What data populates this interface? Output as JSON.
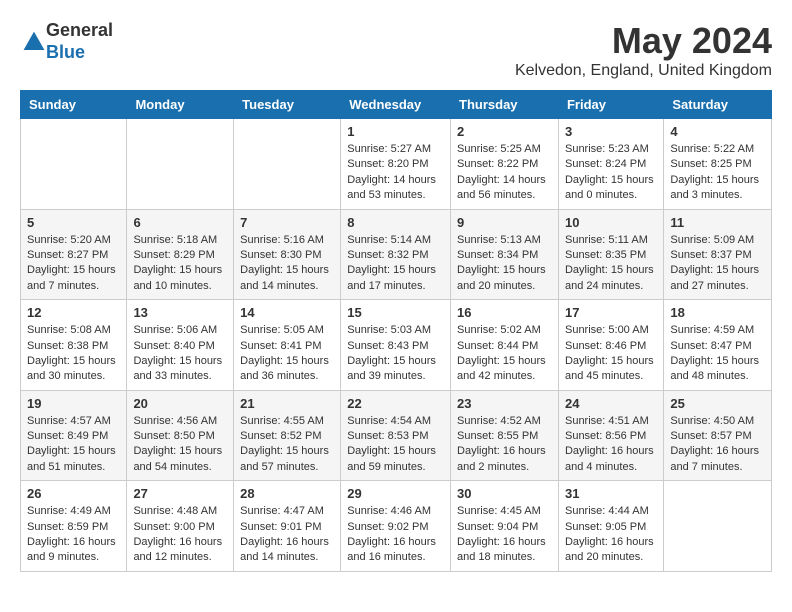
{
  "logo": {
    "general": "General",
    "blue": "Blue"
  },
  "title": "May 2024",
  "location": "Kelvedon, England, United Kingdom",
  "days_of_week": [
    "Sunday",
    "Monday",
    "Tuesday",
    "Wednesday",
    "Thursday",
    "Friday",
    "Saturday"
  ],
  "weeks": [
    [
      {
        "day": "",
        "info": ""
      },
      {
        "day": "",
        "info": ""
      },
      {
        "day": "",
        "info": ""
      },
      {
        "day": "1",
        "info": "Sunrise: 5:27 AM\nSunset: 8:20 PM\nDaylight: 14 hours and 53 minutes."
      },
      {
        "day": "2",
        "info": "Sunrise: 5:25 AM\nSunset: 8:22 PM\nDaylight: 14 hours and 56 minutes."
      },
      {
        "day": "3",
        "info": "Sunrise: 5:23 AM\nSunset: 8:24 PM\nDaylight: 15 hours and 0 minutes."
      },
      {
        "day": "4",
        "info": "Sunrise: 5:22 AM\nSunset: 8:25 PM\nDaylight: 15 hours and 3 minutes."
      }
    ],
    [
      {
        "day": "5",
        "info": "Sunrise: 5:20 AM\nSunset: 8:27 PM\nDaylight: 15 hours and 7 minutes."
      },
      {
        "day": "6",
        "info": "Sunrise: 5:18 AM\nSunset: 8:29 PM\nDaylight: 15 hours and 10 minutes."
      },
      {
        "day": "7",
        "info": "Sunrise: 5:16 AM\nSunset: 8:30 PM\nDaylight: 15 hours and 14 minutes."
      },
      {
        "day": "8",
        "info": "Sunrise: 5:14 AM\nSunset: 8:32 PM\nDaylight: 15 hours and 17 minutes."
      },
      {
        "day": "9",
        "info": "Sunrise: 5:13 AM\nSunset: 8:34 PM\nDaylight: 15 hours and 20 minutes."
      },
      {
        "day": "10",
        "info": "Sunrise: 5:11 AM\nSunset: 8:35 PM\nDaylight: 15 hours and 24 minutes."
      },
      {
        "day": "11",
        "info": "Sunrise: 5:09 AM\nSunset: 8:37 PM\nDaylight: 15 hours and 27 minutes."
      }
    ],
    [
      {
        "day": "12",
        "info": "Sunrise: 5:08 AM\nSunset: 8:38 PM\nDaylight: 15 hours and 30 minutes."
      },
      {
        "day": "13",
        "info": "Sunrise: 5:06 AM\nSunset: 8:40 PM\nDaylight: 15 hours and 33 minutes."
      },
      {
        "day": "14",
        "info": "Sunrise: 5:05 AM\nSunset: 8:41 PM\nDaylight: 15 hours and 36 minutes."
      },
      {
        "day": "15",
        "info": "Sunrise: 5:03 AM\nSunset: 8:43 PM\nDaylight: 15 hours and 39 minutes."
      },
      {
        "day": "16",
        "info": "Sunrise: 5:02 AM\nSunset: 8:44 PM\nDaylight: 15 hours and 42 minutes."
      },
      {
        "day": "17",
        "info": "Sunrise: 5:00 AM\nSunset: 8:46 PM\nDaylight: 15 hours and 45 minutes."
      },
      {
        "day": "18",
        "info": "Sunrise: 4:59 AM\nSunset: 8:47 PM\nDaylight: 15 hours and 48 minutes."
      }
    ],
    [
      {
        "day": "19",
        "info": "Sunrise: 4:57 AM\nSunset: 8:49 PM\nDaylight: 15 hours and 51 minutes."
      },
      {
        "day": "20",
        "info": "Sunrise: 4:56 AM\nSunset: 8:50 PM\nDaylight: 15 hours and 54 minutes."
      },
      {
        "day": "21",
        "info": "Sunrise: 4:55 AM\nSunset: 8:52 PM\nDaylight: 15 hours and 57 minutes."
      },
      {
        "day": "22",
        "info": "Sunrise: 4:54 AM\nSunset: 8:53 PM\nDaylight: 15 hours and 59 minutes."
      },
      {
        "day": "23",
        "info": "Sunrise: 4:52 AM\nSunset: 8:55 PM\nDaylight: 16 hours and 2 minutes."
      },
      {
        "day": "24",
        "info": "Sunrise: 4:51 AM\nSunset: 8:56 PM\nDaylight: 16 hours and 4 minutes."
      },
      {
        "day": "25",
        "info": "Sunrise: 4:50 AM\nSunset: 8:57 PM\nDaylight: 16 hours and 7 minutes."
      }
    ],
    [
      {
        "day": "26",
        "info": "Sunrise: 4:49 AM\nSunset: 8:59 PM\nDaylight: 16 hours and 9 minutes."
      },
      {
        "day": "27",
        "info": "Sunrise: 4:48 AM\nSunset: 9:00 PM\nDaylight: 16 hours and 12 minutes."
      },
      {
        "day": "28",
        "info": "Sunrise: 4:47 AM\nSunset: 9:01 PM\nDaylight: 16 hours and 14 minutes."
      },
      {
        "day": "29",
        "info": "Sunrise: 4:46 AM\nSunset: 9:02 PM\nDaylight: 16 hours and 16 minutes."
      },
      {
        "day": "30",
        "info": "Sunrise: 4:45 AM\nSunset: 9:04 PM\nDaylight: 16 hours and 18 minutes."
      },
      {
        "day": "31",
        "info": "Sunrise: 4:44 AM\nSunset: 9:05 PM\nDaylight: 16 hours and 20 minutes."
      },
      {
        "day": "",
        "info": ""
      }
    ]
  ]
}
